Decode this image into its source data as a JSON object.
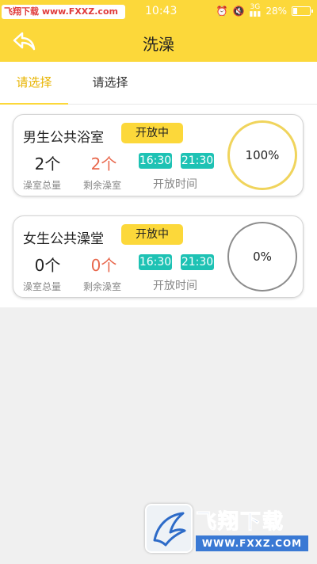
{
  "status_bar": {
    "watermark_cn": "飞翔下载",
    "watermark_url": "www.FXXZ.com",
    "time": "10:43",
    "network": "3G",
    "battery": "28%"
  },
  "header": {
    "title": "洗澡",
    "back_icon": "back-arrow-icon"
  },
  "tabs": [
    {
      "label": "请选择",
      "active": true
    },
    {
      "label": "请选择",
      "active": false
    }
  ],
  "colors": {
    "header": "#fcd83a",
    "active_tab": "#e8b400",
    "remaining_count": "#e8674c",
    "time_chip": "#1ec2b4",
    "ring_active": "#f0d45c",
    "ring_inactive": "#8c8c8c"
  },
  "bathrooms": [
    {
      "name": "男生公共浴室",
      "status": "开放中",
      "total": "2个",
      "total_label": "澡室总量",
      "remaining": "2个",
      "remaining_label": "剩余澡室",
      "open_start": "16:30",
      "open_end": "21:30",
      "open_label": "开放时间",
      "usage": "100%"
    },
    {
      "name": "女生公共澡堂",
      "status": "开放中",
      "total": "0个",
      "total_label": "澡室总量",
      "remaining": "0个",
      "remaining_label": "剩余澡室",
      "open_start": "16:30",
      "open_end": "21:30",
      "open_label": "开放时间",
      "usage": "0%"
    }
  ],
  "bottom_watermark": {
    "brand": "飞翔下载",
    "domain": "WWW.FXXZ.COM"
  }
}
